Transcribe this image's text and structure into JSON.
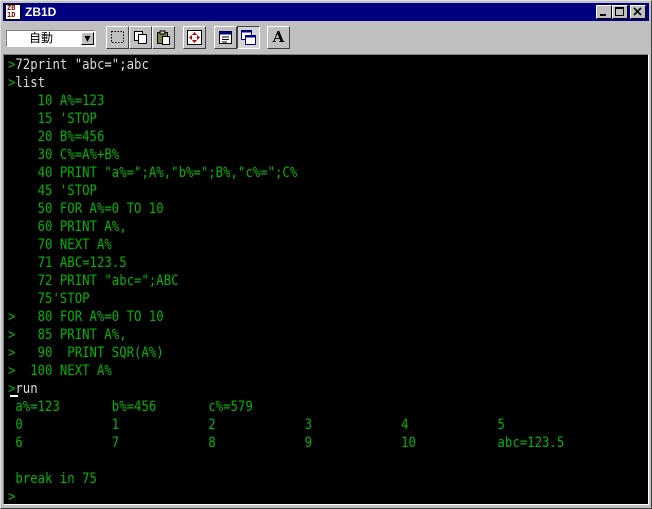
{
  "window": {
    "title": "ZB1D",
    "icon_letters": [
      "ZB",
      "1D"
    ],
    "buttons": [
      "minimize",
      "maximize",
      "close"
    ]
  },
  "toolbar": {
    "mode_select": "自動",
    "tools": [
      "select-area",
      "copy",
      "paste",
      "fullscreen",
      "properties",
      "window-size",
      "font"
    ],
    "font_glyph": "A"
  },
  "colors": {
    "prompt": "#00b400",
    "input_text": "#dcdcdc",
    "output_text": "#00b400",
    "background": "#000000"
  },
  "terminal": {
    "lines": [
      {
        "prompt": ">",
        "text": "72print \"abc=\";abc",
        "style": "white"
      },
      {
        "prompt": ">",
        "text": "list",
        "style": "white"
      },
      {
        "prompt": "",
        "text": "   10 A%=123",
        "style": "green"
      },
      {
        "prompt": "",
        "text": "   15 'STOP",
        "style": "green"
      },
      {
        "prompt": "",
        "text": "   20 B%=456",
        "style": "green"
      },
      {
        "prompt": "",
        "text": "   30 C%=A%+B%",
        "style": "green"
      },
      {
        "prompt": "",
        "text": "   40 PRINT \"a%=\";A%,\"b%=\";B%,\"c%=\";C%",
        "style": "green"
      },
      {
        "prompt": "",
        "text": "   45 'STOP",
        "style": "green"
      },
      {
        "prompt": "",
        "text": "   50 FOR A%=0 TO 10",
        "style": "green"
      },
      {
        "prompt": "",
        "text": "   60 PRINT A%,",
        "style": "green"
      },
      {
        "prompt": "",
        "text": "   70 NEXT A%",
        "style": "green"
      },
      {
        "prompt": "",
        "text": "   71 ABC=123.5",
        "style": "green"
      },
      {
        "prompt": "",
        "text": "   72 PRINT \"abc=\";ABC",
        "style": "green"
      },
      {
        "prompt": "",
        "text": "   75'STOP",
        "style": "green"
      },
      {
        "prompt": ">",
        "text": "   80 FOR A%=0 TO 10",
        "style": "green"
      },
      {
        "prompt": ">",
        "text": "   85 PRINT A%,",
        "style": "green"
      },
      {
        "prompt": ">",
        "text": "   90  PRINT SQR(A%)",
        "style": "green"
      },
      {
        "prompt": ">",
        "text": "  100 NEXT A%",
        "style": "green"
      },
      {
        "prompt": ">",
        "text": "run",
        "style": "white"
      },
      {
        "prompt": "",
        "text": "a%=123       b%=456       c%=579",
        "style": "green"
      },
      {
        "prompt": "",
        "text": "0            1            2            3            4            5",
        "style": "green"
      },
      {
        "prompt": "",
        "text": "6            7            8            9            10           abc=123.5",
        "style": "green"
      },
      {
        "prompt": "",
        "text": "",
        "style": "green"
      },
      {
        "prompt": "",
        "text": "break in 75",
        "style": "green"
      },
      {
        "prompt": ">",
        "text": "",
        "style": "green"
      }
    ]
  }
}
